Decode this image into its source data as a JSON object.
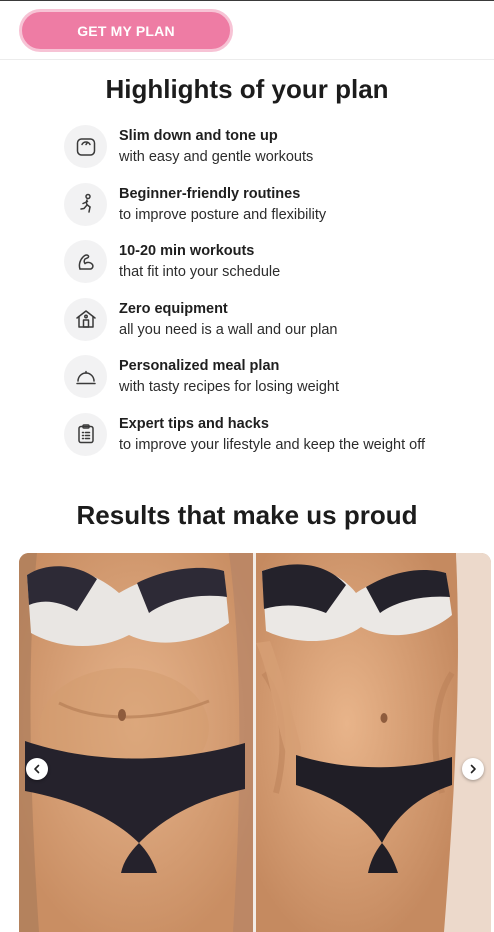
{
  "header": {
    "cta_label": "GET MY PLAN"
  },
  "highlights": {
    "title": "Highlights of your plan",
    "items": [
      {
        "icon": "scale-icon",
        "title": "Slim down and tone up",
        "subtitle": "with easy and gentle workouts"
      },
      {
        "icon": "stretching-person-icon",
        "title": "Beginner-friendly routines",
        "subtitle": "to improve posture and flexibility"
      },
      {
        "icon": "flexed-arm-icon",
        "title": "10-20 min workouts",
        "subtitle": "that fit into your schedule"
      },
      {
        "icon": "home-icon",
        "title": "Zero equipment",
        "subtitle": "all you need is a wall and our plan"
      },
      {
        "icon": "meal-cloche-icon",
        "title": "Personalized meal plan",
        "subtitle": "with tasty recipes for losing weight"
      },
      {
        "icon": "clipboard-checklist-icon",
        "title": "Expert tips and hacks",
        "subtitle": "to improve your lifestyle and keep the weight off"
      }
    ]
  },
  "results": {
    "title": "Results that make us proud",
    "carousel": {
      "images": [
        "before-photo",
        "after-photo"
      ],
      "prev_icon": "chevron-left-icon",
      "next_icon": "chevron-right-icon"
    }
  },
  "colors": {
    "cta_background": "#ee7ca4",
    "cta_border": "#f7c3d5",
    "icon_circle": "#f2f2f3",
    "text_primary": "#1f1f1f"
  }
}
